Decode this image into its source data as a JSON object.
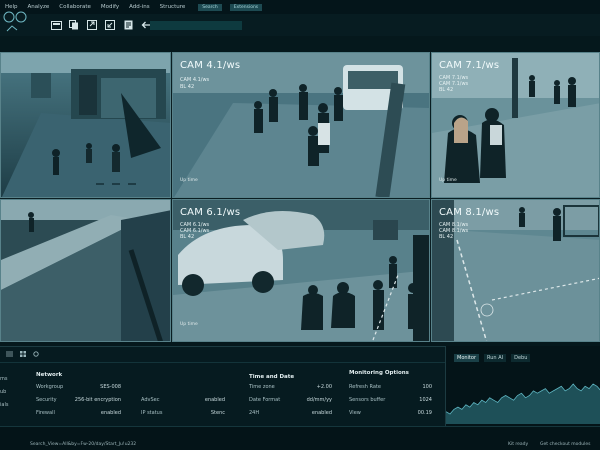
{
  "menu": {
    "items": [
      "Help",
      "Analyze",
      "Collaborate",
      "Modify",
      "Add-ins",
      "Structure"
    ],
    "chip_search": "Search",
    "chip_extensions": "Extensions"
  },
  "cameras": [
    {
      "id": "cam-1",
      "title": "",
      "sub": [],
      "uptime": "",
      "buttons": [
        "",
        "",
        ""
      ]
    },
    {
      "id": "cam-4",
      "title": "CAM 4.1/ws",
      "sub": [
        "CAM 4.1/ws",
        "BL 42"
      ],
      "uptime": "Up time",
      "buttons": []
    },
    {
      "id": "cam-7",
      "title": "CAM 7.1/ws",
      "sub": [
        "CAM 7.1/ws",
        "CAM 7.1/ws",
        "BL 42"
      ],
      "uptime": "Up time",
      "buttons": []
    },
    {
      "id": "cam-2",
      "title": "",
      "sub": [],
      "uptime": "",
      "buttons": []
    },
    {
      "id": "cam-6",
      "title": "CAM 6.1/ws",
      "sub": [
        "CAM 6.1/ws",
        "CAM 6.1/ws",
        "BL 42"
      ],
      "uptime": "Up time",
      "buttons": []
    },
    {
      "id": "cam-8",
      "title": "CAM 8.1/ws",
      "sub": [
        "CAM 8.1/ws",
        "CAM 8.1/ws",
        "BL 42"
      ],
      "uptime": "Up time",
      "buttons": []
    }
  ],
  "panel": {
    "left_tabs": [
      "ms",
      "ub",
      "ials"
    ],
    "network": {
      "title": "Network",
      "rows": [
        {
          "k": "Workgroup",
          "v": "SES-008"
        },
        {
          "k": "Security",
          "v": "256-bit encryption"
        },
        {
          "k": "Firewall",
          "v": "enabled"
        }
      ]
    },
    "adv": {
      "rows": [
        {
          "k": "AdvSec",
          "v": "enabled"
        },
        {
          "k": "IP status",
          "v": "Stenc"
        }
      ]
    },
    "time": {
      "title": "Time and Date",
      "rows": [
        {
          "k": "Time zone",
          "v": "+2.00"
        },
        {
          "k": "Date Format",
          "v": "dd/mm/yy"
        },
        {
          "k": "24H",
          "v": "enabled"
        }
      ]
    },
    "monitoring": {
      "title": "Monitoring Options",
      "rows": [
        {
          "k": "Refresh Rate",
          "v": "100"
        },
        {
          "k": "Sensors buffer",
          "v": "1024"
        },
        {
          "k": "View",
          "v": "00.19"
        }
      ]
    }
  },
  "monitor": {
    "tabs": [
      "Monitor",
      "Run AI",
      "Debu"
    ],
    "chart_data": {
      "type": "area",
      "values": [
        3,
        2,
        4,
        5,
        4,
        6,
        5,
        7,
        6,
        8,
        7,
        9,
        8,
        7,
        9,
        10,
        9,
        8,
        10,
        11,
        9,
        10,
        12,
        11,
        12,
        13,
        11,
        12,
        13,
        14,
        12,
        13,
        15,
        13,
        12,
        14,
        13,
        15,
        14,
        12
      ]
    }
  },
  "status": {
    "line1": "",
    "line2": "Search_View=All&by=Fw-20/day/Start_Ju!u232",
    "ready": "Kit ready",
    "modules": "Get checkout modules"
  },
  "colors": {
    "panel_bg": "#061b20",
    "accent": "#3b8894",
    "border": "#58828a"
  }
}
